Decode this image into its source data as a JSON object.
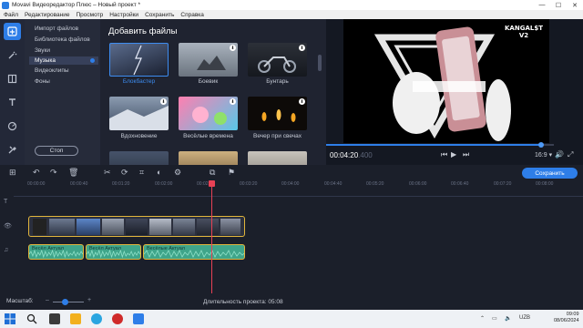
{
  "window": {
    "title": "Movavi Видеоредактор Плюс – Новый проект *",
    "controls": [
      "—",
      "☐",
      "✕"
    ]
  },
  "menu": [
    "Файл",
    "Редактирование",
    "Просмотр",
    "Настройки",
    "Сохранить",
    "Справка"
  ],
  "tools": [
    {
      "icon": "import-icon",
      "active": true
    },
    {
      "icon": "magic-wand-icon",
      "active": false
    },
    {
      "icon": "filters-icon",
      "active": false
    },
    {
      "icon": "titles-icon",
      "active": false
    },
    {
      "icon": "stickers-icon",
      "active": false
    },
    {
      "icon": "more-tools-icon",
      "active": false
    }
  ],
  "categories": {
    "items": [
      "Импорт файлов",
      "Библиотека файлов",
      "Звуки",
      "Музыка",
      "Видеоклипы",
      "Фоны"
    ],
    "selected": "Музыка",
    "stop_label": "Стоп"
  },
  "media": {
    "heading": "Добавить файлы",
    "thumbs": [
      {
        "label": "Блокбастер",
        "selected": true
      },
      {
        "label": "Боевик",
        "selected": false
      },
      {
        "label": "Бунтарь",
        "selected": false
      },
      {
        "label": "Вдохновение",
        "selected": false
      },
      {
        "label": "Весёлые времена",
        "selected": false
      },
      {
        "label": "Вечер при свечах",
        "selected": false
      },
      {
        "label": "",
        "selected": false
      },
      {
        "label": "",
        "selected": false
      },
      {
        "label": "",
        "selected": false
      }
    ]
  },
  "preview": {
    "timecode": "00:04:20",
    "timecode_frac": ".400",
    "ratio": "16:9 ▾",
    "overlay_text": "KANGAL$T V2",
    "progress": 0.94
  },
  "toolbar": {
    "save_label": "Сохранить"
  },
  "ruler": [
    "00:00:00",
    "00:00:40",
    "00:01:20",
    "00:02:00",
    "00:02:40",
    "00:03:20",
    "00:04:00",
    "00:04:40",
    "00:05:20",
    "00:06:00",
    "00:06:40",
    "00:07:20",
    "00:08:00",
    "00:08:40"
  ],
  "timeline": {
    "audio_clips": [
      {
        "label": "Весёл Актуал"
      },
      {
        "label": "Весёл Актуал"
      },
      {
        "label": "Весёлые Актуал"
      }
    ]
  },
  "status": {
    "scale_label": "Масштаб:",
    "duration_label": "Длительность проекта:",
    "duration_value": "05:08"
  },
  "taskbar": {
    "lang": "UZB",
    "time": "09:09",
    "date": "08/06/2024"
  },
  "colors": {
    "accent": "#2e7ee8",
    "clip_border": "#e1b53c",
    "playhead": "#e84155",
    "audio_clip": "#3fa58a"
  }
}
